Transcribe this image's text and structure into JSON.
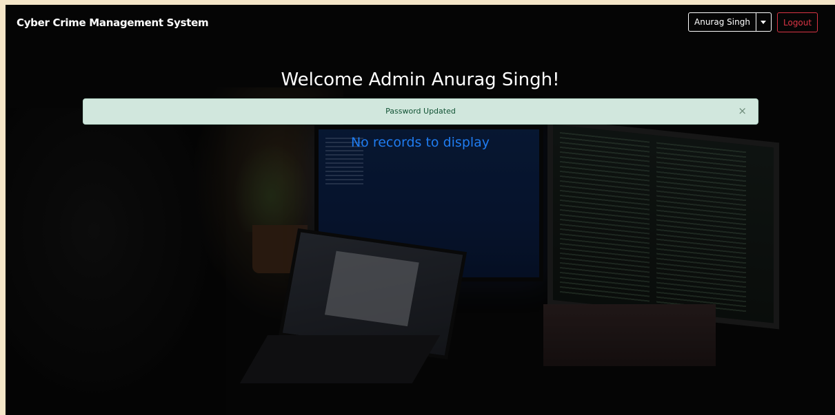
{
  "navbar": {
    "brand": "Cyber Crime Management System",
    "user_name": "Anurag Singh",
    "logout_label": "Logout"
  },
  "main": {
    "welcome_heading": "Welcome Admin Anurag Singh!",
    "alert_message": "Password Updated",
    "alert_close_glyph": "×",
    "empty_message": "No records to display"
  },
  "colors": {
    "logout_red": "#dc3545",
    "alert_bg": "#d1e7dd",
    "empty_message_blue": "#1f7cf0"
  }
}
